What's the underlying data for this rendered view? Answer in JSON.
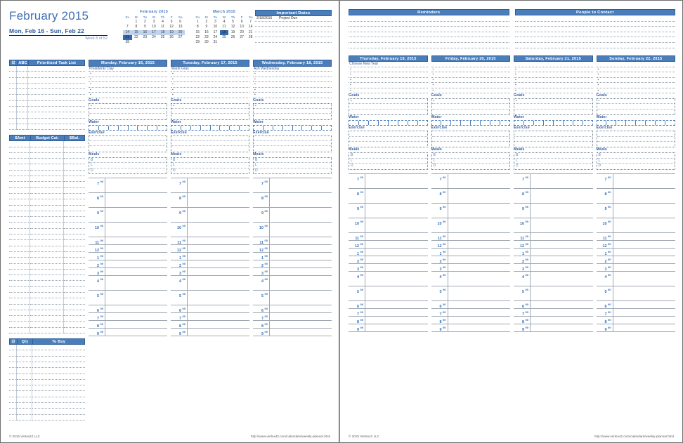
{
  "header": {
    "month_title": "February 2015",
    "date_range": "Mon, Feb 16  -  Sun, Feb 22",
    "week_of": "Week 8 of 52"
  },
  "mini_calendars": [
    {
      "title": "February 2015",
      "weekday_headers": [
        "Su",
        "M",
        "Tu",
        "W",
        "Th",
        "F",
        "Sa"
      ],
      "weeks": [
        [
          {
            "d": ""
          },
          {
            "d": "1"
          },
          {
            "d": "2"
          },
          {
            "d": "3"
          },
          {
            "d": "4"
          },
          {
            "d": "5"
          },
          {
            "d": "6"
          }
        ],
        [
          {
            "d": "7"
          },
          {
            "d": "8"
          },
          {
            "d": "9"
          },
          {
            "d": "10"
          },
          {
            "d": "11"
          },
          {
            "d": "12"
          },
          {
            "d": "13"
          }
        ],
        [
          {
            "d": "14",
            "hl": "wk"
          },
          {
            "d": "15",
            "hl": "wk"
          },
          {
            "d": "16",
            "hl": "wk"
          },
          {
            "d": "17",
            "hl": "wk"
          },
          {
            "d": "18",
            "hl": "wk"
          },
          {
            "d": "19",
            "hl": "wk"
          },
          {
            "d": "20",
            "hl": "wk"
          }
        ],
        [
          {
            "d": "21",
            "hl": "today"
          },
          {
            "d": "22"
          },
          {
            "d": "23"
          },
          {
            "d": "24"
          },
          {
            "d": "25"
          },
          {
            "d": "26"
          },
          {
            "d": "27"
          }
        ],
        [
          {
            "d": "28"
          },
          {
            "d": ""
          },
          {
            "d": ""
          },
          {
            "d": ""
          },
          {
            "d": ""
          },
          {
            "d": ""
          },
          {
            "d": ""
          }
        ]
      ]
    },
    {
      "title": "March 2015",
      "weekday_headers": [
        "Su",
        "M",
        "Tu",
        "W",
        "Th",
        "F",
        "Sa"
      ],
      "weeks": [
        [
          {
            "d": "1"
          },
          {
            "d": "2"
          },
          {
            "d": "3"
          },
          {
            "d": "4"
          },
          {
            "d": "5"
          },
          {
            "d": "6"
          },
          {
            "d": "7"
          }
        ],
        [
          {
            "d": "8"
          },
          {
            "d": "9"
          },
          {
            "d": "10"
          },
          {
            "d": "11"
          },
          {
            "d": "12"
          },
          {
            "d": "13"
          },
          {
            "d": "14"
          }
        ],
        [
          {
            "d": "15"
          },
          {
            "d": "16"
          },
          {
            "d": "17"
          },
          {
            "d": "18",
            "hl": "today"
          },
          {
            "d": "19"
          },
          {
            "d": "20"
          },
          {
            "d": "21"
          }
        ],
        [
          {
            "d": "22"
          },
          {
            "d": "23"
          },
          {
            "d": "24"
          },
          {
            "d": "25"
          },
          {
            "d": "26"
          },
          {
            "d": "27"
          },
          {
            "d": "28"
          }
        ],
        [
          {
            "d": "29"
          },
          {
            "d": "30"
          },
          {
            "d": "31"
          },
          {
            "d": ""
          },
          {
            "d": ""
          },
          {
            "d": ""
          },
          {
            "d": ""
          }
        ]
      ]
    }
  ],
  "important_dates": {
    "title": "Important Dates",
    "entries": [
      {
        "date": "2/18/2015",
        "text": "Project Due"
      },
      {
        "date": "",
        "text": ""
      },
      {
        "date": "",
        "text": ""
      },
      {
        "date": "",
        "text": ""
      },
      {
        "date": "",
        "text": ""
      }
    ]
  },
  "task_list": {
    "columns": [
      "☑",
      "ABC",
      "Prioritized Task List"
    ],
    "row_count": 11
  },
  "budget_list": {
    "columns": [
      "$Amt",
      "Budget Cat.",
      "$Bal."
    ],
    "row_count": 33
  },
  "shopping_list": {
    "columns": [
      "☑",
      "Qty",
      "To Buy"
    ],
    "row_count": 13
  },
  "right_page_top": {
    "reminders_title": "Reminders",
    "people_title": "People to Contact",
    "line_count": 6
  },
  "day_sections": {
    "goals_label": "Goals",
    "water_label": "Water",
    "exercise_label": "Exercise",
    "meals_label": "Meals",
    "meal_bullets": [
      "B",
      "L",
      "D"
    ],
    "goal_bullet": "▪",
    "note_bullet": "▪",
    "water_cups": 8,
    "note_line_count": 5,
    "goal_line_count": 3,
    "exercise_line_count": 3
  },
  "time_slots": [
    {
      "hour": "7",
      "min": "00"
    },
    {
      "hour": "8",
      "min": "00"
    },
    {
      "hour": "9",
      "min": "00"
    },
    {
      "hour": "10",
      "min": "00"
    },
    {
      "hour": "11",
      "min": "00"
    },
    {
      "hour": "12",
      "min": "00"
    },
    {
      "hour": "1",
      "min": "00"
    },
    {
      "hour": "2",
      "min": "00"
    },
    {
      "hour": "3",
      "min": "00"
    },
    {
      "hour": "4",
      "min": "00"
    },
    {
      "hour": "5",
      "min": "00"
    },
    {
      "hour": "6",
      "min": "00"
    },
    {
      "hour": "7",
      "min": "00"
    },
    {
      "hour": "8",
      "min": "00"
    },
    {
      "hour": "9",
      "min": "00"
    }
  ],
  "days": [
    {
      "title": "Monday, February 16, 2015",
      "holiday": "Presidents' Day"
    },
    {
      "title": "Tuesday, February 17, 2015",
      "holiday": "Mardi Gras"
    },
    {
      "title": "Wednesday, February 18, 2015",
      "holiday": "Ash Wednesday"
    },
    {
      "title": "Thursday, February 19, 2015",
      "holiday": "Chinese New Year"
    },
    {
      "title": "Friday, February 20, 2015",
      "holiday": ""
    },
    {
      "title": "Saturday, February 21, 2015",
      "holiday": ""
    },
    {
      "title": "Sunday, February 22, 2015",
      "holiday": ""
    }
  ],
  "footer": {
    "copyright": "© 2015 Vertex42 LLC",
    "url": "http://www.vertex42.com/calendars/weekly-planner.html"
  },
  "colors": {
    "accent_blue": "#4a7ebb",
    "header_border": "#2f5e99",
    "title_blue": "#3f6fb5",
    "week_highlight": "#bfd3ee",
    "today_fill": "#2f6bb5"
  }
}
